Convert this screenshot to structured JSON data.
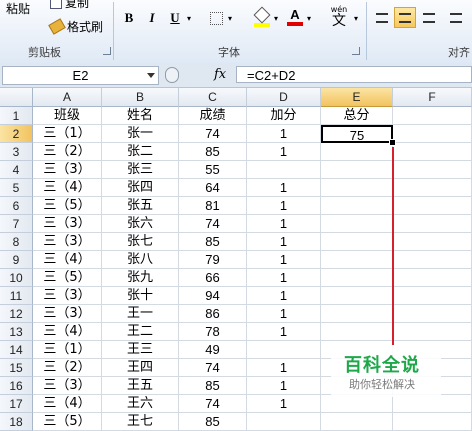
{
  "ribbon": {
    "paste_label": "粘贴",
    "copy_label": "复制",
    "format_painter_label": "格式刷",
    "clipboard_group": "剪贴板",
    "font_group": "字体",
    "align_group": "对齐",
    "bold": "B",
    "italic": "I",
    "underline": "U",
    "phonetic": "wén",
    "phonetic_char": "文",
    "font_color_glyph": "A"
  },
  "formula_bar": {
    "name_box": "E2",
    "fx_label": "fx",
    "formula": "=C2+D2"
  },
  "columns": [
    "A",
    "B",
    "C",
    "D",
    "E",
    "F"
  ],
  "selected_column": "E",
  "rows": [
    {
      "n": "1",
      "a": "班级",
      "b": "姓名",
      "c": "成绩",
      "d": "加分",
      "e": "总分"
    },
    {
      "n": "2",
      "a": "三（1）",
      "b": "张一",
      "c": "74",
      "d": "1",
      "e": "75"
    },
    {
      "n": "3",
      "a": "三（2）",
      "b": "张二",
      "c": "85",
      "d": "1",
      "e": ""
    },
    {
      "n": "4",
      "a": "三（3）",
      "b": "张三",
      "c": "55",
      "d": "",
      "e": ""
    },
    {
      "n": "5",
      "a": "三（4）",
      "b": "张四",
      "c": "64",
      "d": "1",
      "e": ""
    },
    {
      "n": "6",
      "a": "三（5）",
      "b": "张五",
      "c": "81",
      "d": "1",
      "e": ""
    },
    {
      "n": "7",
      "a": "三（3）",
      "b": "张六",
      "c": "74",
      "d": "1",
      "e": ""
    },
    {
      "n": "8",
      "a": "三（3）",
      "b": "张七",
      "c": "85",
      "d": "1",
      "e": ""
    },
    {
      "n": "9",
      "a": "三（4）",
      "b": "张八",
      "c": "79",
      "d": "1",
      "e": ""
    },
    {
      "n": "10",
      "a": "三（5）",
      "b": "张九",
      "c": "66",
      "d": "1",
      "e": ""
    },
    {
      "n": "11",
      "a": "三（3）",
      "b": "张十",
      "c": "94",
      "d": "1",
      "e": ""
    },
    {
      "n": "12",
      "a": "三（3）",
      "b": "王一",
      "c": "86",
      "d": "1",
      "e": ""
    },
    {
      "n": "13",
      "a": "三（4）",
      "b": "王二",
      "c": "78",
      "d": "1",
      "e": ""
    },
    {
      "n": "14",
      "a": "三（1）",
      "b": "王三",
      "c": "49",
      "d": "",
      "e": ""
    },
    {
      "n": "15",
      "a": "三（2）",
      "b": "王四",
      "c": "74",
      "d": "1",
      "e": ""
    },
    {
      "n": "16",
      "a": "三（3）",
      "b": "王五",
      "c": "85",
      "d": "1",
      "e": ""
    },
    {
      "n": "17",
      "a": "三（4）",
      "b": "王六",
      "c": "74",
      "d": "1",
      "e": ""
    },
    {
      "n": "18",
      "a": "三（5）",
      "b": "王七",
      "c": "85",
      "d": "",
      "e": ""
    }
  ],
  "watermark": {
    "title": "百科全说",
    "subtitle": "助你轻松解决"
  },
  "colors": {
    "annotation_line": "#d7202e",
    "watermark_green": "#1fa84a",
    "selection_header": "#f2c35f"
  }
}
